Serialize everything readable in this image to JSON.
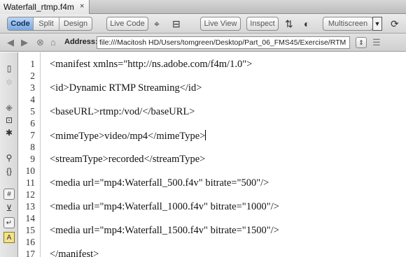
{
  "tab": {
    "title": "Waterfall_rtmp.f4m",
    "close_glyph": "×"
  },
  "toolbar": {
    "code_label": "Code",
    "split_label": "Split",
    "design_label": "Design",
    "live_code_label": "Live Code",
    "live_view_label": "Live View",
    "inspect_label": "Inspect",
    "multiscreen_label": "Multiscreen",
    "active_view": "Code",
    "accent_color": "#7aa7df"
  },
  "address": {
    "label": "Address:",
    "value": "file:///Macitosh HD/Users/tomgreen/Desktop/Part_06_FMS45/Exercise/RTM"
  },
  "icons": {
    "toolbar": [
      "code-navigator-icon",
      "validate-markup-icon",
      "file-management-icon",
      "preview-globe-icon",
      "refresh-icon",
      "view-options-icon"
    ],
    "address": [
      "back-arrow-icon",
      "forward-arrow-icon",
      "stop-icon",
      "home-icon",
      "browser-nav-options-icon",
      "page-list-icon"
    ],
    "coding_toolbar": [
      "open-documents-icon",
      "show-code-navigator-icon",
      "collapse-full-tag-icon",
      "collapse-selection-icon",
      "expand-all-icon",
      "select-parent-tag-icon",
      "balance-braces-icon",
      "line-numbers-icon",
      "highlight-invalid-code-icon",
      "wrap-lines-icon",
      "syntax-coloring-icon"
    ]
  },
  "editor": {
    "line_numbers": [
      "1",
      "2",
      "3",
      "4",
      "5",
      "6",
      "7",
      "8",
      "9",
      "10",
      "11",
      "12",
      "13",
      "14",
      "15",
      "16",
      "17"
    ],
    "lines": [
      "<manifest xmlns=\"http://ns.adobe.com/f4m/1.0\">",
      "",
      "<id>Dynamic RTMP Streaming</id>",
      "",
      "<baseURL>rtmp:/vod/</baseURL>",
      "",
      "<mimeType>video/mp4</mimeType>",
      "",
      "<streamType>recorded</streamType>",
      "",
      "<media url=\"mp4:Waterfall_500.f4v\" bitrate=\"500\"/>",
      "",
      "<media url=\"mp4:Waterfall_1000.f4v\" bitrate=\"1000\"/>",
      "",
      "<media url=\"mp4:Waterfall_1500.f4v\" bitrate=\"1500\"/>",
      "",
      "</manifest>"
    ],
    "caret_line": 7
  }
}
